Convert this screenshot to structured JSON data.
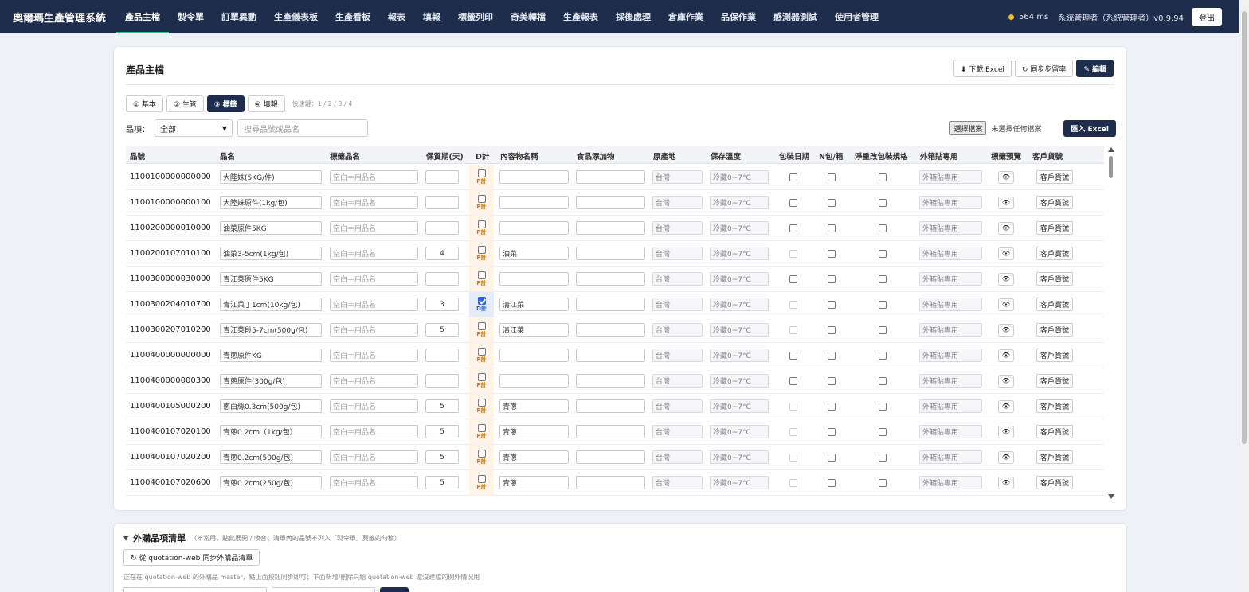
{
  "app": {
    "title": "奧爾瑪生產管理系統",
    "latency": "564 ms",
    "user": "系統管理者（系統管理者）v0.9.94",
    "logout": "登出"
  },
  "nav": [
    "產品主檔",
    "製令單",
    "訂單異動",
    "生產儀表板",
    "生產看板",
    "報表",
    "填報",
    "標籤列印",
    "奇美轉檔",
    "生產報表",
    "採後處理",
    "倉庫作業",
    "品保作業",
    "感測器測試",
    "使用者管理"
  ],
  "page": {
    "title": "產品主檔",
    "download": "⬇ 下載 Excel",
    "sync": "↻ 同步步留率",
    "edit": "✎ 編輯"
  },
  "steps": {
    "items": [
      "① 基本",
      "② 生管",
      "③ 標籤",
      "④ 填報"
    ],
    "active": 2,
    "hint": "快速鍵：1 / 2 / 3 / 4"
  },
  "filters": {
    "label": "品項：",
    "select_value": "全部",
    "search_placeholder": "搜尋品號或品名",
    "file_button": "選擇檔案",
    "file_status": "未選擇任何檔案",
    "import": "匯入 Excel"
  },
  "table": {
    "headers": [
      "品號",
      "品名",
      "標籤品名",
      "保質期(天)",
      "D計",
      "內容物名稱",
      "食品添加物",
      "原產地",
      "保存溫度",
      "包裝日期",
      "N包/箱",
      "淨重改包裝規格",
      "外箱貼專用",
      "標籤預覽",
      "客戶貨號"
    ],
    "label_placeholder": "空白＝用品名",
    "d_tag": "P計",
    "d_tag_selected": "D計",
    "origin": "台灣",
    "temp": "冷藏0~7°C",
    "carton_placeholder": "外箱貼專用",
    "preview": "👁",
    "customer_btn": "客戶貨號",
    "rows": [
      {
        "code": "1100100000000000",
        "name": "大陸妹(5KG/件)",
        "shelf": "",
        "content": "",
        "dchecked": false,
        "pkg_disabled": false
      },
      {
        "code": "1100100000000100",
        "name": "大陸妹原件(1kg/包)",
        "shelf": "",
        "content": "",
        "dchecked": false,
        "pkg_disabled": false
      },
      {
        "code": "1100200000010000",
        "name": "油菜原件5KG",
        "shelf": "",
        "content": "",
        "dchecked": false,
        "pkg_disabled": false
      },
      {
        "code": "1100200107010100",
        "name": "油菜3-5cm(1kg/包)",
        "shelf": "4",
        "content": "油菜",
        "dchecked": false,
        "pkg_disabled": true
      },
      {
        "code": "1100300000030000",
        "name": "青江菜原件5KG",
        "shelf": "",
        "content": "",
        "dchecked": false,
        "pkg_disabled": false
      },
      {
        "code": "1100300204010700",
        "name": "青江菜丁1cm(10kg/包)",
        "shelf": "3",
        "content": "清江菜",
        "dchecked": true,
        "pkg_disabled": true
      },
      {
        "code": "1100300207010200",
        "name": "青江菜段5-7cm(500g/包)",
        "shelf": "5",
        "content": "清江菜",
        "dchecked": false,
        "pkg_disabled": true
      },
      {
        "code": "1100400000000000",
        "name": "青蔥原件KG",
        "shelf": "",
        "content": "",
        "dchecked": false,
        "pkg_disabled": false
      },
      {
        "code": "1100400000000300",
        "name": "青蔥原件(300g/包)",
        "shelf": "",
        "content": "",
        "dchecked": false,
        "pkg_disabled": false
      },
      {
        "code": "1100400105000200",
        "name": "蔥白絲0.3cm(500g/包)",
        "shelf": "5",
        "content": "青蔥",
        "dchecked": false,
        "pkg_disabled": true
      },
      {
        "code": "1100400107020100",
        "name": "青蔥0.2cm（1kg/包）",
        "shelf": "5",
        "content": "青蔥",
        "dchecked": false,
        "pkg_disabled": true
      },
      {
        "code": "1100400107020200",
        "name": "青蔥0.2cm(500g/包)",
        "shelf": "5",
        "content": "青蔥",
        "dchecked": false,
        "pkg_disabled": true
      },
      {
        "code": "1100400107020600",
        "name": "青蔥0.2cm(250g/包)",
        "shelf": "5",
        "content": "青蔥",
        "dchecked": false,
        "pkg_disabled": true
      }
    ]
  },
  "purchased": {
    "title": "外購品項清單",
    "note": "（不常用，點此展開 / 收合；清單內的品號不列入「製令單」頁籤的勾稽）",
    "sync_button": "↻ 從 quotation-web 同步外購品清單",
    "description": "正在在 quotation-web 的外購品 master，點上面按鈕同步即可；下面新增/刪除只給 quotation-web 還沒建檔的例外情況用"
  },
  "colors": {
    "nav_bg": "#1f2d4d",
    "active_tab_underline": "#2fbf8f",
    "d_col_bg": "#fff4e5",
    "check_blue": "#2b63d9"
  }
}
